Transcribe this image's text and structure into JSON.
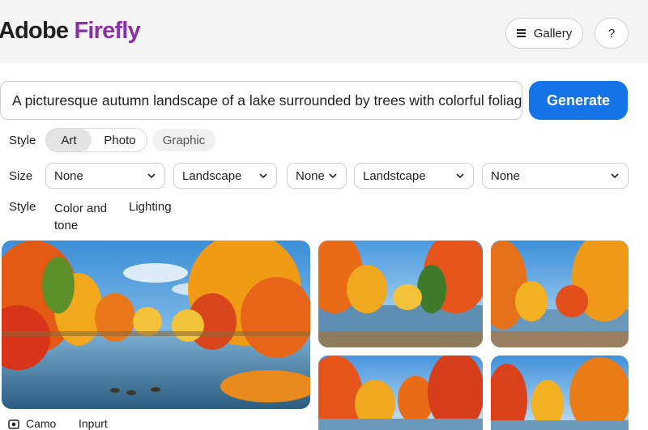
{
  "header": {
    "brand_part1": "Adobe",
    "brand_part2": "Firefly",
    "gallery_label": "Gallery",
    "help_label": "?"
  },
  "prompt": {
    "value": "A picturesque autumn landscape of a lake surrounded by trees with colorful foliag",
    "generate_label": "Generate"
  },
  "style_row": {
    "label": "Style",
    "options": [
      "Art",
      "Photo",
      "Graphic"
    ],
    "selected": "Art"
  },
  "size_row": {
    "label": "Size",
    "dropdowns": [
      "None",
      "Landscape",
      "None",
      "Landstcape",
      "None"
    ]
  },
  "style_row2": {
    "label": "Style",
    "color_tone_line1": "Color and",
    "color_tone_line2": "tone",
    "lighting": "Lighting"
  },
  "footer": {
    "item1": "Camo",
    "item2": "Inpurt"
  },
  "colors": {
    "brand_purple": "#8a2fa8",
    "generate_blue": "#1473e6"
  },
  "icons": [
    "menu-icon",
    "chevron-down-icon",
    "camera-icon"
  ]
}
